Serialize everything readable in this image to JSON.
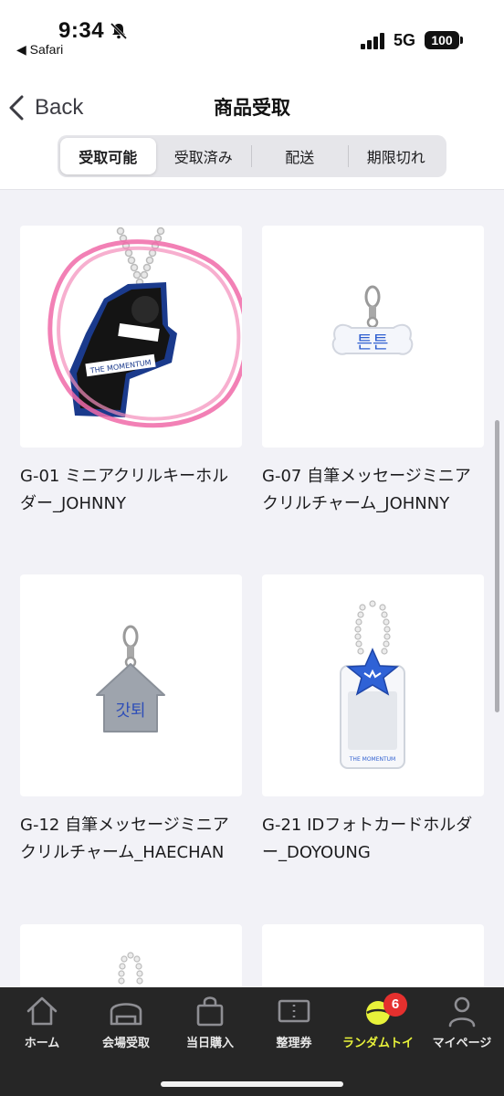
{
  "status_bar": {
    "time": "9:34",
    "back_app": "◀ Safari",
    "network": "5G",
    "battery": "100"
  },
  "nav": {
    "back_label": "Back",
    "title": "商品受取"
  },
  "segments": [
    {
      "label": "受取可能",
      "active": true
    },
    {
      "label": "受取済み",
      "active": false
    },
    {
      "label": "配送",
      "active": false
    },
    {
      "label": "期限切れ",
      "active": false
    }
  ],
  "products": [
    {
      "title": "G-01 ミニアクリルキーホルダー_JOHNNY",
      "image_text": "THE MOMENTUM"
    },
    {
      "title": "G-07 自筆メッセージミニアクリルチャーム_JOHNNY",
      "image_text": "튼튼"
    },
    {
      "title": "G-12 自筆メッセージミニアクリルチャーム_HAECHAN",
      "image_text": "갓퇴"
    },
    {
      "title": "G-21 IDフォトカードホルダー_DOYOUNG",
      "image_text": "THE MOMENTUM"
    }
  ],
  "tabs": [
    {
      "label": "ホーム",
      "icon": "home-icon",
      "active": false
    },
    {
      "label": "会場受取",
      "icon": "venue-icon",
      "active": false
    },
    {
      "label": "当日購入",
      "icon": "shopping-bag-icon",
      "active": false
    },
    {
      "label": "整理券",
      "icon": "ticket-icon",
      "active": false
    },
    {
      "label": "ランダムトイ",
      "icon": "random-toy-icon",
      "active": true,
      "badge": "6"
    },
    {
      "label": "マイページ",
      "icon": "person-icon",
      "active": false
    }
  ],
  "colors": {
    "accent_active_tab": "#e8f23a",
    "badge": "#e5302e",
    "tab_bar_bg": "#262626",
    "page_bg": "#f2f2f7"
  }
}
